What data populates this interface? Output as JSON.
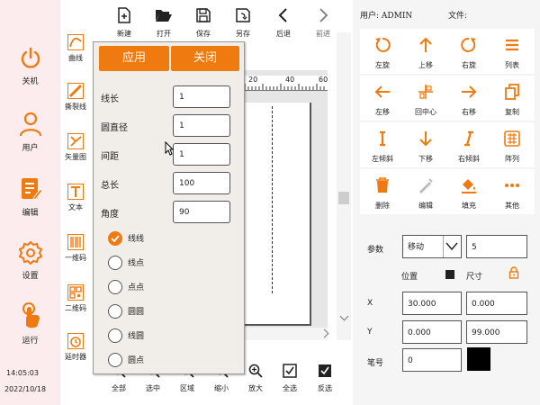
{
  "sidebar": {
    "items": [
      {
        "label": "关机",
        "icon": "power-icon"
      },
      {
        "label": "用户",
        "icon": "user-icon"
      },
      {
        "label": "编辑",
        "icon": "edit-icon"
      },
      {
        "label": "设置",
        "icon": "settings-gear-icon"
      },
      {
        "label": "运行",
        "icon": "run-hand-icon"
      }
    ],
    "time": "14:05:03",
    "date": "2022/10/18"
  },
  "tools": {
    "items": [
      {
        "label": "曲线",
        "icon": "curve-icon"
      },
      {
        "label": "撕裂线",
        "icon": "tear-line-icon"
      },
      {
        "label": "矢量图",
        "icon": "vector-icon"
      },
      {
        "label": "文本",
        "icon": "text-icon"
      },
      {
        "label": "一维码",
        "icon": "barcode-icon"
      },
      {
        "label": "二维码",
        "icon": "qrcode-icon"
      },
      {
        "label": "延时器",
        "icon": "timer-icon"
      }
    ]
  },
  "toolbar": {
    "items": [
      {
        "label": "新建",
        "icon": "new-file-icon"
      },
      {
        "label": "打开",
        "icon": "open-folder-icon"
      },
      {
        "label": "保存",
        "icon": "save-icon"
      },
      {
        "label": "另存",
        "icon": "save-as-icon"
      },
      {
        "label": "后退",
        "icon": "back-icon"
      },
      {
        "label": "前进",
        "icon": "forward-icon"
      }
    ]
  },
  "bottombar": {
    "items": [
      {
        "label": "全部",
        "icon": "zoom-all-icon"
      },
      {
        "label": "选中",
        "icon": "zoom-selected-icon"
      },
      {
        "label": "区域",
        "icon": "zoom-area-icon"
      },
      {
        "label": "缩小",
        "icon": "zoom-out-icon"
      },
      {
        "label": "放大",
        "icon": "zoom-in-icon"
      },
      {
        "label": "全选",
        "icon": "select-all-icon"
      },
      {
        "label": "反选",
        "icon": "invert-select-icon"
      }
    ]
  },
  "ruler": {
    "ticks": [
      "20",
      "40",
      "60"
    ]
  },
  "popup": {
    "apply_label": "应用",
    "close_label": "关闭",
    "fields": [
      {
        "label": "线长",
        "value": "1"
      },
      {
        "label": "圆直径",
        "value": "1"
      },
      {
        "label": "间距",
        "value": "1"
      },
      {
        "label": "总长",
        "value": "100"
      },
      {
        "label": "角度",
        "value": "90"
      }
    ],
    "options": [
      {
        "label": "线线",
        "selected": true
      },
      {
        "label": "线点",
        "selected": false
      },
      {
        "label": "点点",
        "selected": false
      },
      {
        "label": "圆圆",
        "selected": false
      },
      {
        "label": "线圆",
        "selected": false
      },
      {
        "label": "圆点",
        "selected": false
      }
    ]
  },
  "rightpanel": {
    "user_label": "用户: ADMIN",
    "file_label": "文件:",
    "grid": [
      {
        "label": "左旋",
        "icon": "rotate-left-icon"
      },
      {
        "label": "上移",
        "icon": "arrow-up-icon"
      },
      {
        "label": "右旋",
        "icon": "rotate-right-icon"
      },
      {
        "label": "列表",
        "icon": "list-icon"
      },
      {
        "label": "左移",
        "icon": "arrow-left-icon"
      },
      {
        "label": "回中心",
        "icon": "center-icon"
      },
      {
        "label": "右移",
        "icon": "arrow-right-icon"
      },
      {
        "label": "复制",
        "icon": "copy-icon"
      },
      {
        "label": "左倾斜",
        "icon": "skew-left-icon"
      },
      {
        "label": "下移",
        "icon": "arrow-down-icon"
      },
      {
        "label": "右倾斜",
        "icon": "skew-right-icon"
      },
      {
        "label": "阵列",
        "icon": "array-icon"
      },
      {
        "label": "删除",
        "icon": "delete-icon"
      },
      {
        "label": "编辑",
        "icon": "edit-disabled-icon"
      },
      {
        "label": "填充",
        "icon": "fill-icon"
      },
      {
        "label": "其他",
        "icon": "more-icon"
      }
    ],
    "param_label": "参数",
    "mode_value": "移动",
    "step_value": "5",
    "position_label": "位置",
    "size_label": "尺寸",
    "x_label": "X",
    "y_label": "Y",
    "pos_x": "30.000",
    "pos_y": "0.000",
    "size_w": "0.000",
    "size_h": "99.000",
    "pen_label": "笔号",
    "pen_value": "0",
    "pen_color": "#000000"
  },
  "colors": {
    "accent": "#ef7a10"
  }
}
